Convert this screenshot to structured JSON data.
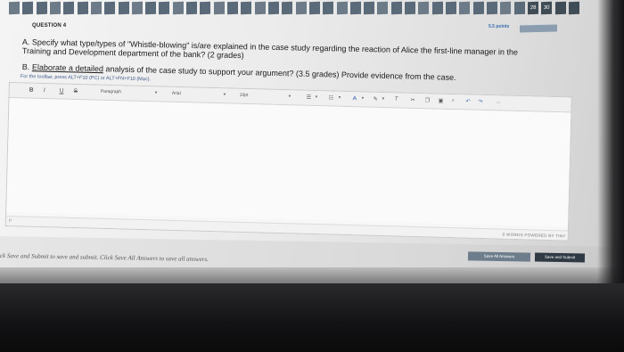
{
  "status_strip": {
    "cells": [
      "",
      "",
      "",
      "",
      "",
      "",
      "",
      "",
      "",
      "",
      "",
      "",
      "",
      "",
      "",
      "",
      "",
      "",
      "",
      "",
      "",
      "",
      "",
      "",
      "",
      "",
      "",
      "",
      "",
      "",
      "",
      "",
      "",
      "",
      "",
      "",
      "",
      "",
      "28",
      "30",
      "",
      ""
    ]
  },
  "question": {
    "label": "QUESTION 4",
    "points": "5.5 points",
    "line1": "A. Specify what type/types of \"Whistle-blowing\" is/are explained in the case study regarding the reaction of Alice the first-line manager in the",
    "line2": "Training and Development department of the bank? (2 grades)",
    "line3_prefix": "B. ",
    "line3_underlined": "Elaborate a detailed",
    "line3_suffix": " analysis of the case study to support your argument? (3.5 grades) Provide evidence from the case."
  },
  "hint": "For the toolbar, press ALT+F10 (PC) or ALT+FN+F10 (Mac).",
  "toolbar": {
    "bold": "B",
    "italic": "I",
    "underline": "U",
    "strike": "S",
    "paragraph": "Paragraph",
    "font": "Arial",
    "size": "10pt",
    "more": "..."
  },
  "editor": {
    "path": "P",
    "word_count": "0 WORDS  POWERED BY TINY"
  },
  "footer": {
    "text": "ck Save and Submit to save and submit. Click Save All Answers to save all answers.",
    "save_all": "Save All Answers",
    "save_submit": "Save and Submit"
  }
}
